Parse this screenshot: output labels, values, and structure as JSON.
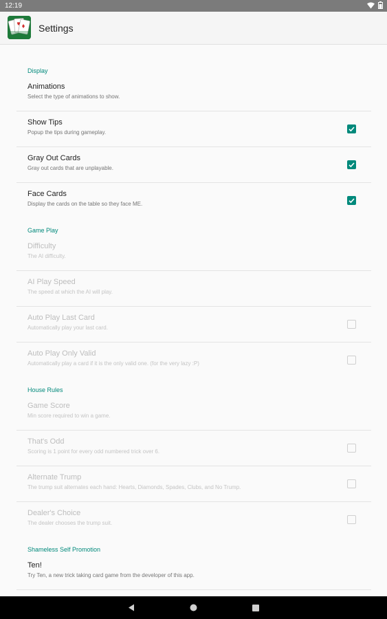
{
  "status_bar": {
    "time": "12:19"
  },
  "app_bar": {
    "title": "Settings"
  },
  "categories": [
    {
      "title": "Display"
    },
    {
      "title": "Game Play"
    },
    {
      "title": "House Rules"
    },
    {
      "title": "Shameless Self Promotion"
    }
  ],
  "display": [
    {
      "title": "Animations",
      "summary": "Select the type of animations to show."
    },
    {
      "title": "Show Tips",
      "summary": "Popup the tips during gameplay.",
      "checked": true
    },
    {
      "title": "Gray Out Cards",
      "summary": "Gray out cards that are unplayable.",
      "checked": true
    },
    {
      "title": "Face Cards",
      "summary": "Display the cards on the table so they face ME.",
      "checked": true
    }
  ],
  "game_play": [
    {
      "title": "Difficulty",
      "summary": "The AI difficulty."
    },
    {
      "title": "AI Play Speed",
      "summary": "The speed at which the AI will play."
    },
    {
      "title": "Auto Play Last Card",
      "summary": "Automatically play your last card.",
      "checked": false
    },
    {
      "title": "Auto Play Only Valid",
      "summary": "Automatically play a card if it is the only valid one. (for the very lazy :P)",
      "checked": false
    }
  ],
  "house_rules": [
    {
      "title": "Game Score",
      "summary": "Min score required to win a game."
    },
    {
      "title": "That's Odd",
      "summary": "Scoring is 1 point for every odd numbered trick over 6.",
      "checked": false
    },
    {
      "title": "Alternate Trump",
      "summary": "The trump suit alternates each hand: Hearts, Diamonds, Spades, Clubs, and No Trump.",
      "checked": false
    },
    {
      "title": "Dealer's Choice",
      "summary": "The dealer chooses the trump suit.",
      "checked": false
    }
  ],
  "promotion": [
    {
      "title": "Ten!",
      "summary": "Try Ten, a new trick taking card game from the developer of this app."
    }
  ],
  "colors": {
    "accent": "#00897b",
    "status_bar": "#7b7b7b",
    "nav_bar": "#000000",
    "app_icon": "#1e7a3a"
  }
}
